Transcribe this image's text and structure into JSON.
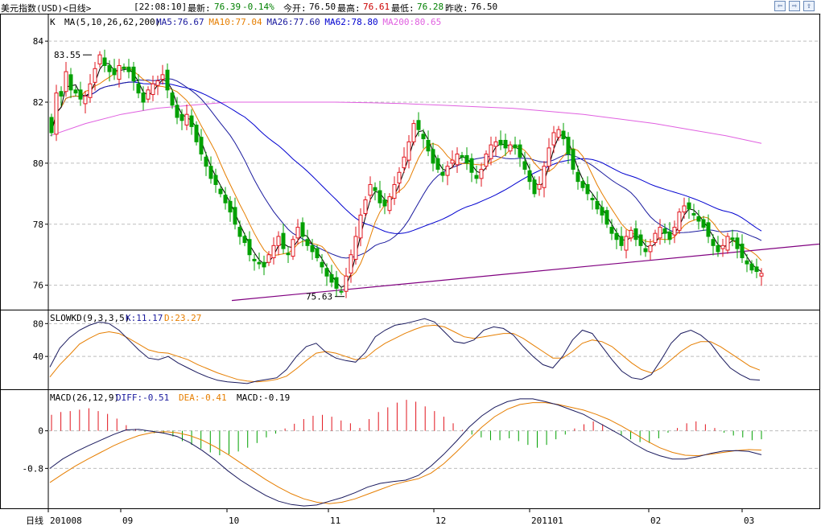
{
  "header": {
    "instrument": "美元指数(USD)<日线>",
    "time": "[22:08:10]",
    "latest_label": "最新:",
    "latest_value": "76.39",
    "change_pct": "-0.14%",
    "open_label": "今开:",
    "open_value": "76.50",
    "high_label": "最高:",
    "high_value": "76.61",
    "low_label": "最低:",
    "low_value": "76.28",
    "prev_close_label": "昨收:",
    "prev_close_value": "76.50"
  },
  "nav_buttons": [
    "⇦",
    "⇨",
    "⇧"
  ],
  "colors": {
    "up_candle": "#e2141d",
    "down_candle": "#00a000",
    "ma5": "#000000",
    "ma10": "#e67e00",
    "ma26": "#1a1a9e",
    "ma62": "#0000d0",
    "ma200": "#e060e0",
    "trendline": "#800080",
    "macd_pos": "#e2141d",
    "macd_neg": "#00a000",
    "highlight_red": "#cc0000",
    "highlight_green": "#008000"
  },
  "chart_data": [
    {
      "type": "candlestick",
      "panel": "price",
      "indicator_label": "K",
      "ma_label": "MA(5,10,26,62,200)",
      "ma_values": [
        {
          "name": "MA5:",
          "value": "76.67"
        },
        {
          "name": "MA10:",
          "value": "77.04"
        },
        {
          "name": "MA26:",
          "value": "77.60"
        },
        {
          "name": "MA62:",
          "value": "78.80"
        },
        {
          "name": "MA200:",
          "value": "80.65"
        }
      ],
      "y_ticks": [
        "84",
        "82",
        "80",
        "78",
        "76"
      ],
      "ylim": [
        75.2,
        84.9
      ],
      "annotations": [
        {
          "text": "83.55",
          "value": 83.55
        },
        {
          "text": "75.63",
          "value": 75.63
        }
      ],
      "trendline": {
        "start": 75.5,
        "end": 77.35
      },
      "close": [
        81.0,
        82.3,
        82.2,
        83.0,
        82.4,
        82.3,
        82.1,
        82.2,
        82.6,
        83.1,
        83.55,
        83.2,
        83.0,
        82.9,
        83.2,
        83.1,
        83.0,
        82.7,
        82.3,
        82.0,
        82.4,
        82.6,
        82.7,
        82.9,
        82.4,
        81.9,
        81.5,
        81.4,
        81.6,
        81.2,
        80.7,
        80.3,
        79.9,
        79.5,
        79.3,
        79.0,
        78.7,
        78.4,
        78.0,
        77.6,
        77.4,
        77.0,
        76.8,
        76.7,
        76.6,
        77.0,
        77.3,
        77.6,
        77.2,
        77.0,
        77.5,
        77.9,
        77.6,
        77.3,
        77.1,
        76.9,
        76.6,
        76.3,
        76.1,
        75.9,
        75.8,
        76.3,
        77.0,
        77.6,
        78.3,
        78.8,
        79.3,
        79.1,
        78.7,
        78.6,
        78.9,
        79.3,
        79.7,
        80.2,
        80.7,
        81.3,
        81.1,
        80.8,
        80.4,
        80.0,
        79.8,
        79.6,
        79.9,
        80.1,
        80.3,
        80.2,
        80.0,
        79.7,
        79.5,
        79.8,
        80.3,
        80.6,
        80.7,
        80.6,
        80.5,
        80.6,
        80.5,
        80.2,
        79.8,
        79.4,
        79.0,
        79.3,
        79.9,
        80.5,
        81.0,
        81.1,
        80.8,
        80.3,
        79.8,
        79.4,
        79.2,
        79.0,
        78.8,
        78.5,
        78.3,
        78.0,
        77.7,
        77.5,
        77.3,
        77.6,
        77.8,
        77.5,
        77.3,
        77.1,
        77.3,
        77.7,
        77.9,
        77.7,
        77.5,
        77.9,
        78.4,
        78.6,
        78.5,
        78.3,
        78.1,
        77.9,
        77.6,
        77.3,
        77.1,
        77.3,
        77.6,
        77.5,
        77.2,
        76.9,
        76.7,
        76.5,
        76.45,
        76.39
      ],
      "ma200": [
        80.9,
        81.3,
        81.6,
        81.8,
        81.9,
        82.0,
        82.0,
        82.0,
        82.0,
        81.98,
        81.95,
        81.9,
        81.85,
        81.8,
        81.7,
        81.6,
        81.45,
        81.3,
        81.1,
        80.9,
        80.65
      ]
    },
    {
      "type": "line",
      "panel": "slowkd",
      "indicator_label": "SLOWKD(9,3,3,5)",
      "values_text": [
        {
          "name": "K:",
          "value": "11.17"
        },
        {
          "name": "D:",
          "value": "23.27"
        }
      ],
      "y_ticks": [
        "80",
        "40"
      ],
      "ylim": [
        0,
        95
      ],
      "series": [
        {
          "name": "K",
          "values": [
            27,
            50,
            63,
            72,
            78,
            82,
            80,
            72,
            60,
            48,
            38,
            36,
            40,
            32,
            26,
            20,
            15,
            11,
            9,
            8,
            7,
            10,
            12,
            14,
            24,
            40,
            52,
            56,
            45,
            38,
            35,
            33,
            45,
            64,
            72,
            78,
            80,
            83,
            86,
            82,
            70,
            58,
            56,
            60,
            72,
            76,
            74,
            66,
            52,
            40,
            30,
            26,
            40,
            60,
            72,
            68,
            52,
            36,
            22,
            14,
            12,
            18,
            36,
            56,
            68,
            72,
            66,
            56,
            40,
            26,
            18,
            12,
            11.17
          ]
        },
        {
          "name": "D",
          "values": [
            15,
            30,
            42,
            55,
            62,
            68,
            70,
            68,
            62,
            55,
            48,
            45,
            44,
            40,
            36,
            30,
            25,
            20,
            16,
            12,
            10,
            9,
            10,
            12,
            16,
            25,
            35,
            44,
            46,
            44,
            40,
            36,
            38,
            48,
            56,
            62,
            68,
            73,
            77,
            78,
            76,
            70,
            64,
            62,
            64,
            66,
            68,
            68,
            62,
            54,
            46,
            38,
            38,
            46,
            56,
            60,
            58,
            52,
            42,
            32,
            24,
            20,
            26,
            36,
            46,
            54,
            58,
            58,
            52,
            44,
            36,
            28,
            23.27
          ]
        }
      ]
    },
    {
      "type": "bar",
      "panel": "macd",
      "indicator_label": "MACD(26,12,9)",
      "values_text": [
        {
          "name": "DIFF:",
          "value": "-0.51"
        },
        {
          "name": "DEA:",
          "value": "-0.41"
        },
        {
          "name": "MACD:",
          "value": "-0.19"
        }
      ],
      "y_ticks": [
        "0",
        "-0.8"
      ],
      "ylim": [
        -1.65,
        0.85
      ],
      "series": [
        {
          "name": "DIFF",
          "values": [
            -0.8,
            -0.6,
            -0.45,
            -0.32,
            -0.2,
            -0.08,
            0.02,
            0.03,
            -0.01,
            -0.05,
            -0.12,
            -0.25,
            -0.42,
            -0.62,
            -0.85,
            -1.05,
            -1.22,
            -1.38,
            -1.5,
            -1.57,
            -1.6,
            -1.58,
            -1.5,
            -1.42,
            -1.32,
            -1.2,
            -1.12,
            -1.08,
            -1.05,
            -0.95,
            -0.75,
            -0.5,
            -0.22,
            0.08,
            0.32,
            0.5,
            0.62,
            0.68,
            0.68,
            0.62,
            0.55,
            0.45,
            0.35,
            0.2,
            0.05,
            -0.1,
            -0.28,
            -0.43,
            -0.53,
            -0.6,
            -0.6,
            -0.55,
            -0.48,
            -0.43,
            -0.42,
            -0.44,
            -0.51
          ]
        },
        {
          "name": "DEA",
          "values": [
            -1.1,
            -0.92,
            -0.75,
            -0.6,
            -0.46,
            -0.32,
            -0.2,
            -0.1,
            -0.04,
            -0.02,
            -0.04,
            -0.1,
            -0.2,
            -0.34,
            -0.5,
            -0.68,
            -0.86,
            -1.04,
            -1.2,
            -1.34,
            -1.45,
            -1.52,
            -1.55,
            -1.52,
            -1.45,
            -1.35,
            -1.25,
            -1.15,
            -1.08,
            -1.02,
            -0.9,
            -0.7,
            -0.45,
            -0.18,
            0.08,
            0.3,
            0.46,
            0.56,
            0.6,
            0.6,
            0.56,
            0.5,
            0.44,
            0.35,
            0.24,
            0.1,
            -0.06,
            -0.22,
            -0.36,
            -0.46,
            -0.52,
            -0.53,
            -0.5,
            -0.46,
            -0.42,
            -0.4,
            -0.41
          ]
        },
        {
          "name": "MACD",
          "values": [
            0.34,
            0.4,
            0.42,
            0.45,
            0.48,
            0.42,
            0.36,
            0.26,
            0.12,
            0.04,
            -0.02,
            -0.05,
            -0.06,
            -0.12,
            -0.22,
            -0.3,
            -0.38,
            -0.46,
            -0.52,
            -0.5,
            -0.44,
            -0.36,
            -0.26,
            -0.14,
            -0.06,
            0.05,
            0.15,
            0.25,
            0.32,
            0.34,
            0.3,
            0.22,
            0.16,
            0.06,
            0.25,
            0.4,
            0.5,
            0.6,
            0.66,
            0.62,
            0.52,
            0.42,
            0.3,
            0.16,
            0.02,
            -0.08,
            -0.14,
            -0.2,
            -0.2,
            -0.16,
            -0.22,
            -0.3,
            -0.36,
            -0.3,
            -0.18,
            -0.08,
            0.05,
            0.14,
            0.2,
            0.14,
            0.02,
            -0.1,
            -0.18,
            -0.24,
            -0.26,
            -0.16,
            -0.04,
            0.06,
            0.16,
            0.2,
            0.14,
            0.06,
            -0.04,
            -0.1,
            -0.14,
            -0.2,
            -0.18
          ]
        }
      ]
    }
  ],
  "x_axis": {
    "corner_label": "日线",
    "ticks": [
      "201008",
      "09",
      "10",
      "11",
      "12",
      "201101",
      "02",
      "03"
    ]
  }
}
